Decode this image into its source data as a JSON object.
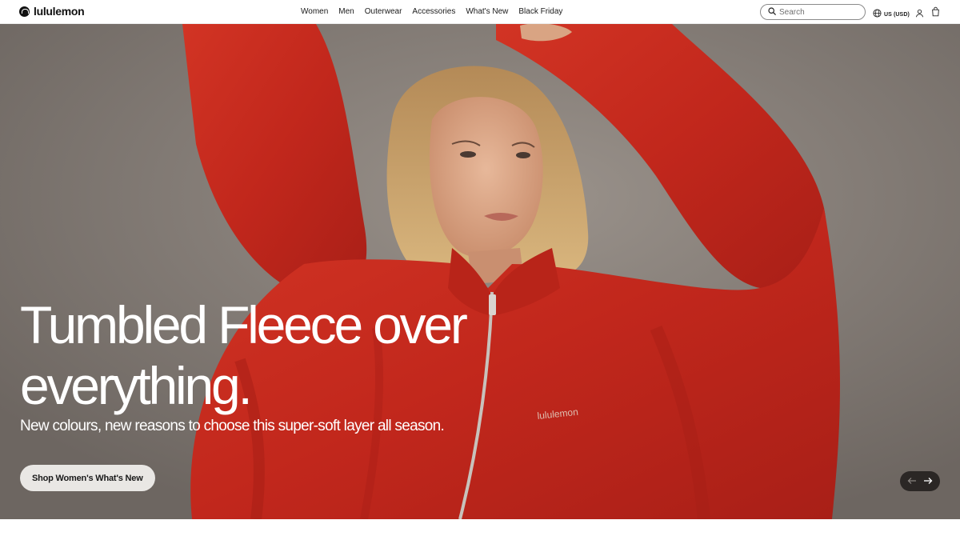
{
  "brand": {
    "name": "lululemon"
  },
  "nav": {
    "items": [
      {
        "label": "Women"
      },
      {
        "label": "Men"
      },
      {
        "label": "Outerwear"
      },
      {
        "label": "Accessories"
      },
      {
        "label": "What's New"
      },
      {
        "label": "Black Friday"
      }
    ]
  },
  "search": {
    "placeholder": "Search",
    "icon": "search-icon"
  },
  "locale": {
    "label": "US (USD)",
    "icon": "globe-icon"
  },
  "utility": {
    "account_icon": "user-icon",
    "bag_icon": "shopping-bag-icon"
  },
  "hero": {
    "headline_line1": "Tumbled Fleece over",
    "headline_line2": "everything.",
    "subheadline": "New colours, new reasons to choose this super-soft layer all season.",
    "cta_label": "Shop Women's What's New",
    "garment_logo_text": "lululemon",
    "carousel": {
      "prev_icon": "arrow-left-icon",
      "next_icon": "arrow-right-icon"
    }
  },
  "colors": {
    "fleece_red": "#c8281e",
    "backdrop": "#8a837d",
    "cta_bg": "#e9e7e4",
    "carousel_bg": "#2b2725"
  }
}
